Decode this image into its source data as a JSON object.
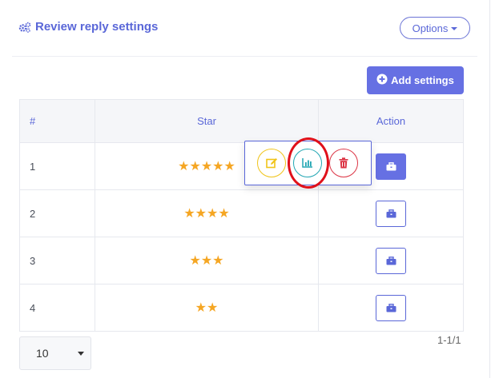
{
  "header": {
    "title": "Review reply settings",
    "title_icon": "gears-icon",
    "options_label": "Options"
  },
  "toolbar": {
    "add_label": "Add settings",
    "add_icon": "plus-circle-icon"
  },
  "table": {
    "columns": [
      "#",
      "Star",
      "Action"
    ],
    "rows": [
      {
        "num": "1",
        "stars": "★★★★★"
      },
      {
        "num": "2",
        "stars": "★★★★"
      },
      {
        "num": "3",
        "stars": "★★★"
      },
      {
        "num": "4",
        "stars": "★★"
      }
    ],
    "action_icon": "briefcase-icon",
    "action_menu": [
      {
        "icon": "edit-icon",
        "color": "#f0c419"
      },
      {
        "icon": "bar-chart-icon",
        "color": "#22a6b3"
      },
      {
        "icon": "trash-icon",
        "color": "#dc3545"
      }
    ]
  },
  "pagination": {
    "page_size": "10",
    "page_info": "1-1/1"
  },
  "colors": {
    "accent": "#5a67d8",
    "button": "#6670e3",
    "star": "#f5a623",
    "highlight": "#e0101a"
  }
}
